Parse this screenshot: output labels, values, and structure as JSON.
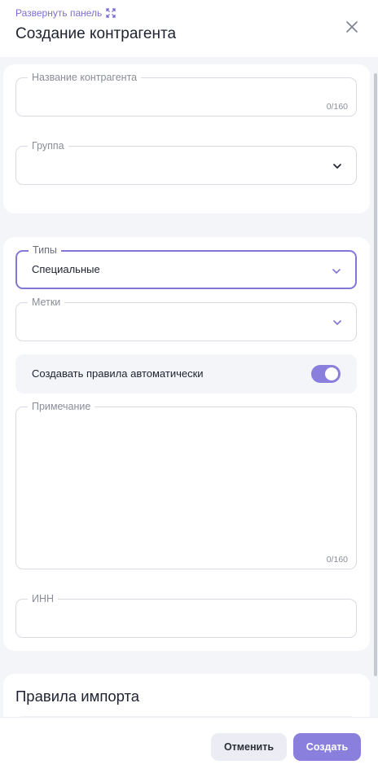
{
  "header": {
    "expand_label": "Развернуть панель",
    "title": "Создание контрагента"
  },
  "form": {
    "name": {
      "label": "Название контрагента",
      "value": "",
      "counter": "0/160"
    },
    "group": {
      "label": "Группа",
      "value": ""
    },
    "types": {
      "label": "Типы",
      "value": "Специальные"
    },
    "tags": {
      "label": "Метки",
      "value": ""
    },
    "auto_rules": {
      "label": "Создавать правила автоматически",
      "enabled": true
    },
    "note": {
      "label": "Примечание",
      "value": "",
      "counter": "0/160"
    },
    "inn": {
      "label": "ИНН",
      "value": ""
    }
  },
  "import_rules": {
    "title": "Правила импорта"
  },
  "footer": {
    "cancel_label": "Отменить",
    "create_label": "Создать"
  },
  "colors": {
    "accent": "#8a7fdc",
    "background": "#f4f5f8"
  },
  "icons": [
    "expand-icon",
    "close-icon",
    "chevron-down-icon"
  ]
}
